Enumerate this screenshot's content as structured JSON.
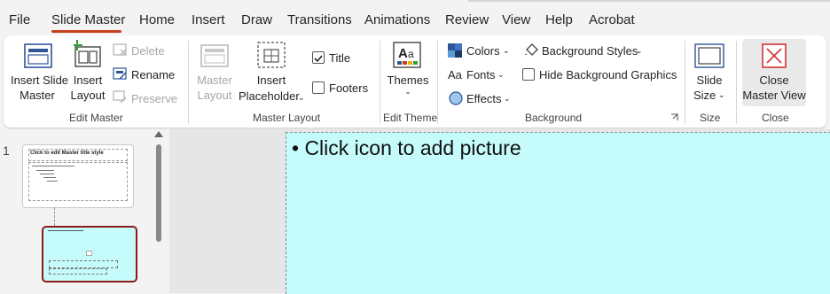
{
  "tabs": [
    "File",
    "Slide Master",
    "Home",
    "Insert",
    "Draw",
    "Transitions",
    "Animations",
    "Review",
    "View",
    "Help",
    "Acrobat"
  ],
  "active_tab": "Slide Master",
  "accent_color": "#c43e1c",
  "ribbon": {
    "edit_master": {
      "insert_slide_master": [
        "Insert Slide",
        "Master"
      ],
      "insert_layout": [
        "Insert",
        "Layout"
      ],
      "delete": "Delete",
      "rename": "Rename",
      "preserve": "Preserve",
      "group_label": "Edit Master"
    },
    "master_layout": {
      "master_layout": [
        "Master",
        "Layout"
      ],
      "insert_placeholder": [
        "Insert",
        "Placeholder"
      ],
      "title_checkbox": "Title",
      "title_checked": true,
      "footers_checkbox": "Footers",
      "footers_checked": false,
      "group_label": "Master Layout"
    },
    "edit_theme": {
      "themes": "Themes",
      "group_label": "Edit Theme"
    },
    "background": {
      "colors": "Colors",
      "fonts": "Fonts",
      "effects": "Effects",
      "background_styles": "Background Styles",
      "hide_background_graphics": "Hide Background Graphics",
      "hide_checked": false,
      "group_label": "Background"
    },
    "size": {
      "slide_size": [
        "Slide",
        "Size"
      ],
      "group_label": "Size"
    },
    "close": {
      "close_master_view": [
        "Close",
        "Master View"
      ],
      "group_label": "Close"
    }
  },
  "thumbnails": {
    "slide_number": "1",
    "master_title": "Click to edit Master title style"
  },
  "slide": {
    "bullet_text": "• Click icon to add picture",
    "background_color": "#c6fbfb"
  }
}
